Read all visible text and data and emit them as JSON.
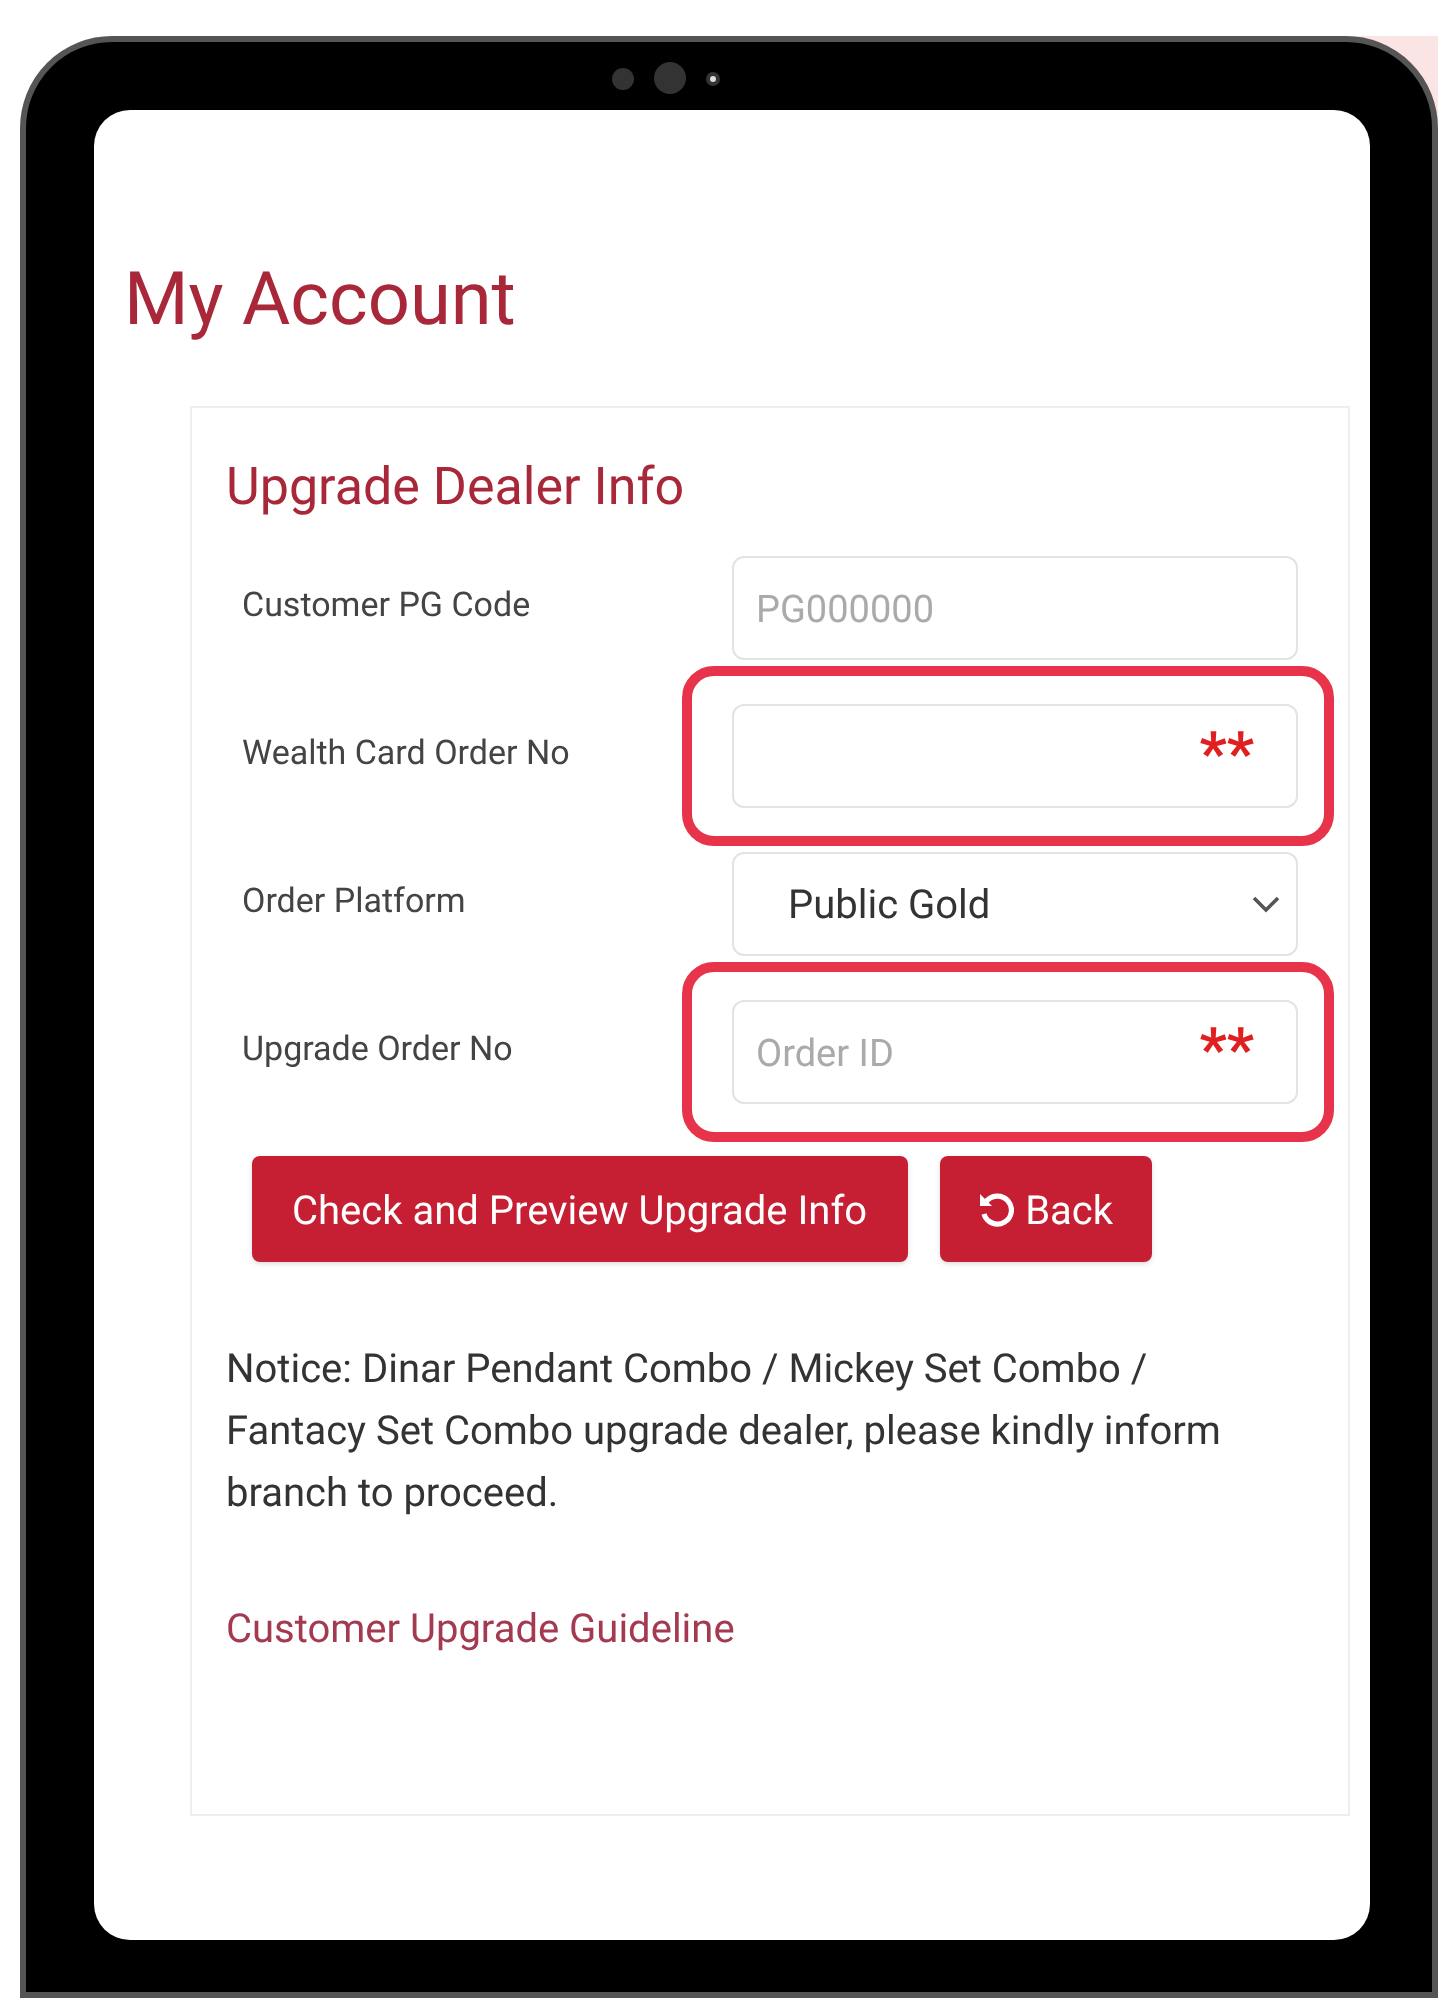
{
  "page": {
    "title": "My Account"
  },
  "card": {
    "title": "Upgrade Dealer Info",
    "fields": [
      {
        "label": "Customer PG Code",
        "kind": "text",
        "placeholder": "PG000000",
        "highlighted": false
      },
      {
        "label": "Wealth Card Order No",
        "kind": "text",
        "highlighted": true,
        "mark": "**"
      },
      {
        "label": "Order Platform",
        "kind": "select",
        "value": "Public Gold",
        "highlighted": false
      },
      {
        "label": "Upgrade Order No",
        "kind": "text",
        "placeholder": "Order ID",
        "highlighted": true,
        "mark": "**"
      }
    ],
    "buttons": [
      {
        "label": "Check and Preview Upgrade Info",
        "kind": "primary"
      },
      {
        "label": "Back",
        "kind": "back"
      }
    ],
    "notice": "Notice: Dinar Pendant Combo / Mickey Set Combo / Fantacy Set Combo upgrade dealer, please kindly inform branch to proceed.",
    "link": "Customer Upgrade Guideline"
  }
}
